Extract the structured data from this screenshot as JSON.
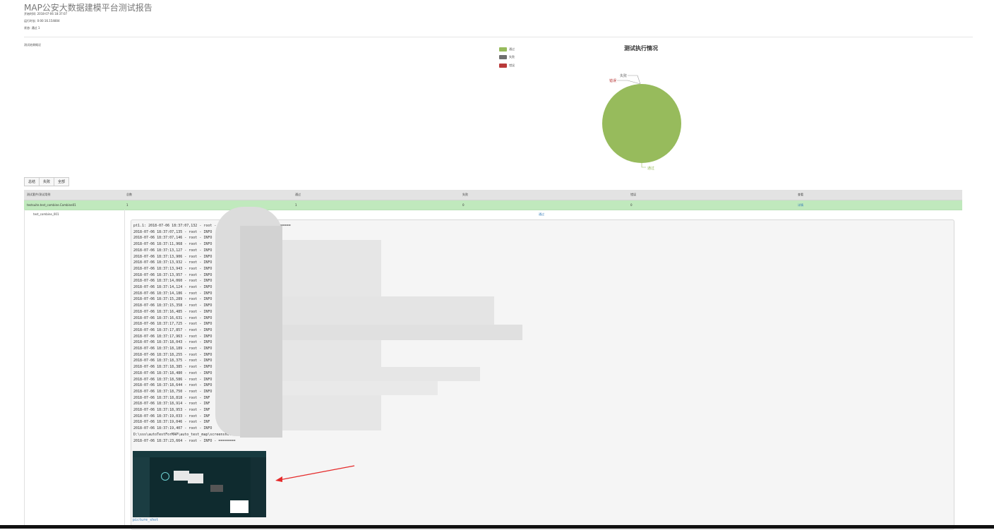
{
  "report": {
    "title": "MAP公安大数据建模平台测试报告",
    "start_time": "开始时间: 2018-07-06 18:37:07",
    "duration": "运行时长: 0:00:16.154804",
    "status": "状态: 通过 1"
  },
  "overview_label": "测试结果概况",
  "chart_data": {
    "type": "pie",
    "title": "测试执行情况",
    "categories": [
      "通过",
      "失败",
      "错误"
    ],
    "values": [
      1,
      0,
      0
    ],
    "colors": [
      "#97bb5c",
      "#6f6f6f",
      "#b93a3a"
    ],
    "legend": "top-left"
  },
  "filter_buttons": [
    "总结",
    "失败",
    "全部"
  ],
  "table": {
    "headers": [
      "测试套件/测试用例",
      "总数",
      "通过",
      "失败",
      "错误",
      "查看"
    ],
    "row": {
      "name": "testsuite.test_combine.Combine01",
      "total": "1",
      "pass": "1",
      "fail": "0",
      "error": "0",
      "view": "详情"
    },
    "case_name": "test_combine_001",
    "log_link": "通过"
  },
  "log": {
    "lines": [
      "pt1.1: 2018-07-06 18:37:07,132 - root - INFO - ===========================",
      "2018-07-06 18:37:07,135 - root - INFO",
      "2018-07-06 18:37:07,146 - root - INFO",
      "2018-07-06 18:37:11,968 - root - INFO",
      "2018-07-06 18:37:13,127 - root - INFO",
      "2018-07-06 18:37:13,906 - root - INFO",
      "2018-07-06 18:37:13,932 - root - INFO",
      "2018-07-06 18:37:13,943 - root - INFO",
      "2018-07-06 18:37:13,957 - root - INFO",
      "2018-07-06 18:37:14,060 - root - INFO",
      "2018-07-06 18:37:14,124 - root - INFO",
      "2018-07-06 18:37:14,186 - root - INFO",
      "2018-07-06 18:37:15,289 - root - INFO",
      "2018-07-06 18:37:15,358 - root - INFO",
      "2018-07-06 18:37:16,485 - root - INFO",
      "2018-07-06 18:37:16,631 - root - INFO",
      "2018-07-06 18:37:17,725 - root - INFO",
      "2018-07-06 18:37:17,857 - root - INFO",
      "2018-07-06 18:37:17,963 - root - INFO",
      "2018-07-06 18:37:18,043 - root - INFO",
      "2018-07-06 18:37:18,189 - root - INFO",
      "2018-07-06 18:37:18,255 - root - INFO",
      "2018-07-06 18:37:18,375 - root - INFO",
      "2018-07-06 18:37:18,385 - root - INFO",
      "2018-07-06 18:37:18,480 - root - INFO",
      "2018-07-06 18:37:18,586 - root - INFO",
      "2018-07-06 18:37:18,644 - root - INFO",
      "2018-07-06 18:37:18,750 - root - INFO",
      "2018-07-06 18:37:18,818 - root - INF",
      "2018-07-06 18:37:18,914 - root - INF",
      "2018-07-06 18:37:18,953 - root - INF",
      "2018-07-06 18:37:19,033 - root - INF",
      "2018-07-06 18:37:19,046 - root - INF",
      "2018-07-06 18:37:19,407 - root - INFO",
      "D:\\sss\\autoTestForMAP\\auto_test_map\\screenshot",
      "2018-07-06 18:37:23,664 - root - INFO - ========"
    ],
    "picture_link": "picture_shot"
  }
}
